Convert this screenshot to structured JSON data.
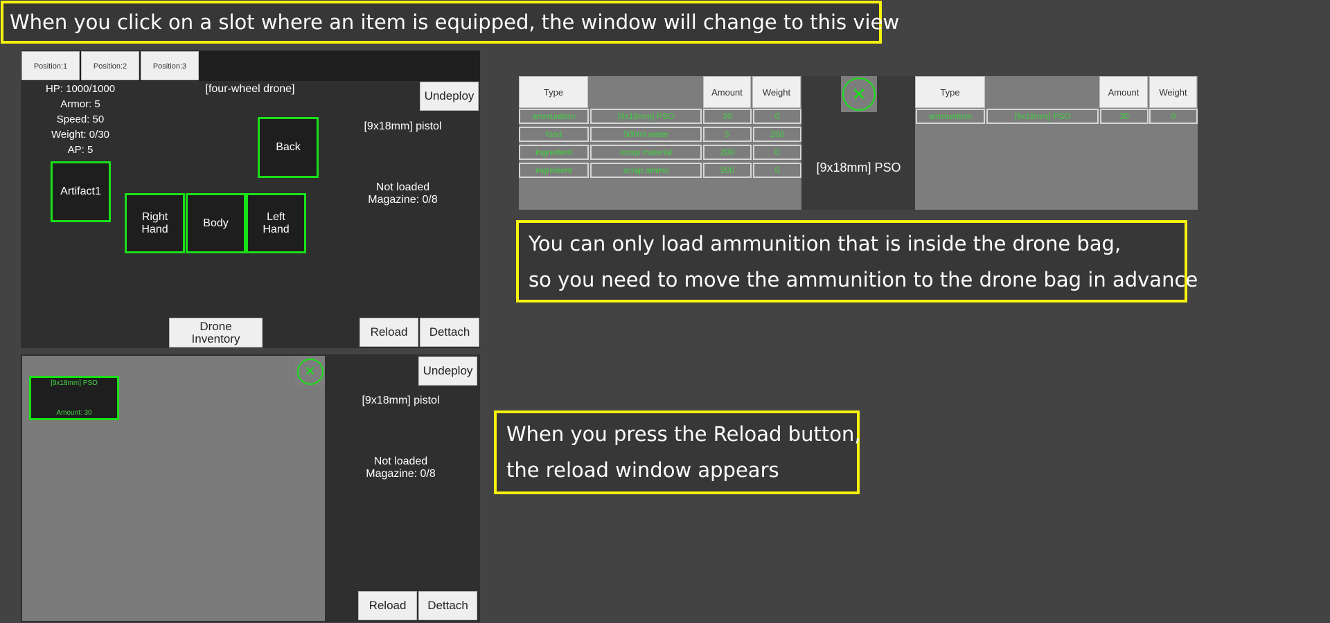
{
  "callouts": {
    "top": "When you click on a slot where an item is equipped, the window will change to this view",
    "mid_line1": "You can only load ammunition that is inside the drone bag,",
    "mid_line2": "so you need to move the ammunition to the drone bag in advance",
    "low_line1": "When you press the Reload button,",
    "low_line2": "the reload window appears"
  },
  "panel1": {
    "tabs": [
      "Position:1",
      "Position:2",
      "Position:3"
    ],
    "stats": {
      "hp": "HP: 1000/1000",
      "armor": "Armor: 5",
      "speed": "Speed: 50",
      "weight": "Weight: 0/30",
      "ap": "AP: 5"
    },
    "drone_name": "[four-wheel drone]",
    "slots": {
      "artifact": "Artifact1",
      "back": "Back",
      "right_hand_1": "Right",
      "right_hand_2": "Hand",
      "body": "Body",
      "left_hand_1": "Left",
      "left_hand_2": "Hand"
    },
    "undeploy": "Undeploy",
    "weapon_name": "[9x18mm] pistol",
    "load_status": "Not loaded",
    "magazine": "Magazine: 0/8",
    "drone_inventory_1": "Drone",
    "drone_inventory_2": "Inventory",
    "reload": "Reload",
    "detach": "Dettach"
  },
  "panel2": {
    "bag_item": {
      "name": "[9x18mm] PSO",
      "amount": "Amount: 30"
    },
    "close_icon": "✕",
    "undeploy": "Undeploy",
    "weapon_name": "[9x18mm] pistol",
    "load_status": "Not loaded",
    "magazine": "Magazine: 0/8",
    "reload": "Reload",
    "detach": "Dettach"
  },
  "reload_window": {
    "left_headers": {
      "type": "Type",
      "amount": "Amount",
      "weight": "Weight"
    },
    "left_rows": [
      {
        "type": "ammunition",
        "name": "[9x18mm] PSO",
        "amount": "20",
        "weight": "0"
      },
      {
        "type": "food",
        "name": "500ml water",
        "amount": "5",
        "weight": "250"
      },
      {
        "type": "ingredient",
        "name": "scrap material",
        "amount": "200",
        "weight": "0"
      },
      {
        "type": "ingredient",
        "name": "scrap ammo",
        "amount": "200",
        "weight": "0"
      }
    ],
    "close_icon": "✕",
    "selected_name": "[9x18mm] PSO",
    "right_headers": {
      "type": "Type",
      "amount": "Amount",
      "weight": "Weight"
    },
    "right_rows": [
      {
        "type": "ammunition",
        "name": "[9x18mm] PSO",
        "amount": "30",
        "weight": "0"
      }
    ]
  },
  "colors": {
    "background": "#434343",
    "callout_border": "#f7f20e",
    "slot_border": "#19e019",
    "item_text": "#3fd03f"
  }
}
